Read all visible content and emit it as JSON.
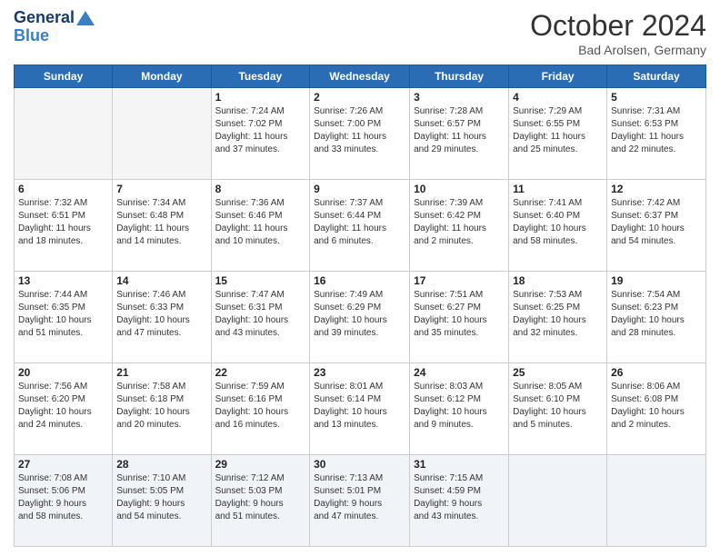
{
  "header": {
    "logo_line1": "General",
    "logo_line2": "Blue",
    "month_title": "October 2024",
    "location": "Bad Arolsen, Germany"
  },
  "days_of_week": [
    "Sunday",
    "Monday",
    "Tuesday",
    "Wednesday",
    "Thursday",
    "Friday",
    "Saturday"
  ],
  "weeks": [
    [
      {
        "day": "",
        "info": ""
      },
      {
        "day": "",
        "info": ""
      },
      {
        "day": "1",
        "info": "Sunrise: 7:24 AM\nSunset: 7:02 PM\nDaylight: 11 hours\nand 37 minutes."
      },
      {
        "day": "2",
        "info": "Sunrise: 7:26 AM\nSunset: 7:00 PM\nDaylight: 11 hours\nand 33 minutes."
      },
      {
        "day": "3",
        "info": "Sunrise: 7:28 AM\nSunset: 6:57 PM\nDaylight: 11 hours\nand 29 minutes."
      },
      {
        "day": "4",
        "info": "Sunrise: 7:29 AM\nSunset: 6:55 PM\nDaylight: 11 hours\nand 25 minutes."
      },
      {
        "day": "5",
        "info": "Sunrise: 7:31 AM\nSunset: 6:53 PM\nDaylight: 11 hours\nand 22 minutes."
      }
    ],
    [
      {
        "day": "6",
        "info": "Sunrise: 7:32 AM\nSunset: 6:51 PM\nDaylight: 11 hours\nand 18 minutes."
      },
      {
        "day": "7",
        "info": "Sunrise: 7:34 AM\nSunset: 6:48 PM\nDaylight: 11 hours\nand 14 minutes."
      },
      {
        "day": "8",
        "info": "Sunrise: 7:36 AM\nSunset: 6:46 PM\nDaylight: 11 hours\nand 10 minutes."
      },
      {
        "day": "9",
        "info": "Sunrise: 7:37 AM\nSunset: 6:44 PM\nDaylight: 11 hours\nand 6 minutes."
      },
      {
        "day": "10",
        "info": "Sunrise: 7:39 AM\nSunset: 6:42 PM\nDaylight: 11 hours\nand 2 minutes."
      },
      {
        "day": "11",
        "info": "Sunrise: 7:41 AM\nSunset: 6:40 PM\nDaylight: 10 hours\nand 58 minutes."
      },
      {
        "day": "12",
        "info": "Sunrise: 7:42 AM\nSunset: 6:37 PM\nDaylight: 10 hours\nand 54 minutes."
      }
    ],
    [
      {
        "day": "13",
        "info": "Sunrise: 7:44 AM\nSunset: 6:35 PM\nDaylight: 10 hours\nand 51 minutes."
      },
      {
        "day": "14",
        "info": "Sunrise: 7:46 AM\nSunset: 6:33 PM\nDaylight: 10 hours\nand 47 minutes."
      },
      {
        "day": "15",
        "info": "Sunrise: 7:47 AM\nSunset: 6:31 PM\nDaylight: 10 hours\nand 43 minutes."
      },
      {
        "day": "16",
        "info": "Sunrise: 7:49 AM\nSunset: 6:29 PM\nDaylight: 10 hours\nand 39 minutes."
      },
      {
        "day": "17",
        "info": "Sunrise: 7:51 AM\nSunset: 6:27 PM\nDaylight: 10 hours\nand 35 minutes."
      },
      {
        "day": "18",
        "info": "Sunrise: 7:53 AM\nSunset: 6:25 PM\nDaylight: 10 hours\nand 32 minutes."
      },
      {
        "day": "19",
        "info": "Sunrise: 7:54 AM\nSunset: 6:23 PM\nDaylight: 10 hours\nand 28 minutes."
      }
    ],
    [
      {
        "day": "20",
        "info": "Sunrise: 7:56 AM\nSunset: 6:20 PM\nDaylight: 10 hours\nand 24 minutes."
      },
      {
        "day": "21",
        "info": "Sunrise: 7:58 AM\nSunset: 6:18 PM\nDaylight: 10 hours\nand 20 minutes."
      },
      {
        "day": "22",
        "info": "Sunrise: 7:59 AM\nSunset: 6:16 PM\nDaylight: 10 hours\nand 16 minutes."
      },
      {
        "day": "23",
        "info": "Sunrise: 8:01 AM\nSunset: 6:14 PM\nDaylight: 10 hours\nand 13 minutes."
      },
      {
        "day": "24",
        "info": "Sunrise: 8:03 AM\nSunset: 6:12 PM\nDaylight: 10 hours\nand 9 minutes."
      },
      {
        "day": "25",
        "info": "Sunrise: 8:05 AM\nSunset: 6:10 PM\nDaylight: 10 hours\nand 5 minutes."
      },
      {
        "day": "26",
        "info": "Sunrise: 8:06 AM\nSunset: 6:08 PM\nDaylight: 10 hours\nand 2 minutes."
      }
    ],
    [
      {
        "day": "27",
        "info": "Sunrise: 7:08 AM\nSunset: 5:06 PM\nDaylight: 9 hours\nand 58 minutes."
      },
      {
        "day": "28",
        "info": "Sunrise: 7:10 AM\nSunset: 5:05 PM\nDaylight: 9 hours\nand 54 minutes."
      },
      {
        "day": "29",
        "info": "Sunrise: 7:12 AM\nSunset: 5:03 PM\nDaylight: 9 hours\nand 51 minutes."
      },
      {
        "day": "30",
        "info": "Sunrise: 7:13 AM\nSunset: 5:01 PM\nDaylight: 9 hours\nand 47 minutes."
      },
      {
        "day": "31",
        "info": "Sunrise: 7:15 AM\nSunset: 4:59 PM\nDaylight: 9 hours\nand 43 minutes."
      },
      {
        "day": "",
        "info": ""
      },
      {
        "day": "",
        "info": ""
      }
    ]
  ]
}
